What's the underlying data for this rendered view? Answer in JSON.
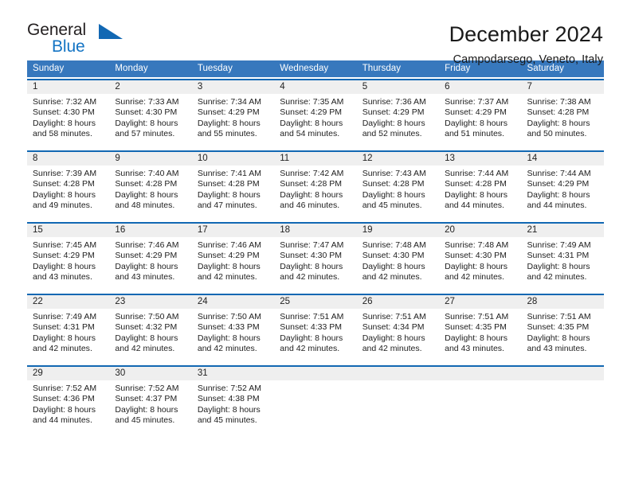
{
  "logo": {
    "word1": "General",
    "word2": "Blue",
    "triangle_color": "#1268b3",
    "word2_color": "#1474c4"
  },
  "header": {
    "title": "December 2024",
    "subtitle": "Campodarsego, Veneto, Italy"
  },
  "theme": {
    "header_row_bg": "#3778bd",
    "week_border": "#1268b3",
    "day_band_bg": "#efefef",
    "text": "#1a1a1a"
  },
  "weekdays": [
    "Sunday",
    "Monday",
    "Tuesday",
    "Wednesday",
    "Thursday",
    "Friday",
    "Saturday"
  ],
  "weeks": [
    [
      {
        "day": "1",
        "sunrise": "Sunrise: 7:32 AM",
        "sunset": "Sunset: 4:30 PM",
        "daylight1": "Daylight: 8 hours",
        "daylight2": "and 58 minutes."
      },
      {
        "day": "2",
        "sunrise": "Sunrise: 7:33 AM",
        "sunset": "Sunset: 4:30 PM",
        "daylight1": "Daylight: 8 hours",
        "daylight2": "and 57 minutes."
      },
      {
        "day": "3",
        "sunrise": "Sunrise: 7:34 AM",
        "sunset": "Sunset: 4:29 PM",
        "daylight1": "Daylight: 8 hours",
        "daylight2": "and 55 minutes."
      },
      {
        "day": "4",
        "sunrise": "Sunrise: 7:35 AM",
        "sunset": "Sunset: 4:29 PM",
        "daylight1": "Daylight: 8 hours",
        "daylight2": "and 54 minutes."
      },
      {
        "day": "5",
        "sunrise": "Sunrise: 7:36 AM",
        "sunset": "Sunset: 4:29 PM",
        "daylight1": "Daylight: 8 hours",
        "daylight2": "and 52 minutes."
      },
      {
        "day": "6",
        "sunrise": "Sunrise: 7:37 AM",
        "sunset": "Sunset: 4:29 PM",
        "daylight1": "Daylight: 8 hours",
        "daylight2": "and 51 minutes."
      },
      {
        "day": "7",
        "sunrise": "Sunrise: 7:38 AM",
        "sunset": "Sunset: 4:28 PM",
        "daylight1": "Daylight: 8 hours",
        "daylight2": "and 50 minutes."
      }
    ],
    [
      {
        "day": "8",
        "sunrise": "Sunrise: 7:39 AM",
        "sunset": "Sunset: 4:28 PM",
        "daylight1": "Daylight: 8 hours",
        "daylight2": "and 49 minutes."
      },
      {
        "day": "9",
        "sunrise": "Sunrise: 7:40 AM",
        "sunset": "Sunset: 4:28 PM",
        "daylight1": "Daylight: 8 hours",
        "daylight2": "and 48 minutes."
      },
      {
        "day": "10",
        "sunrise": "Sunrise: 7:41 AM",
        "sunset": "Sunset: 4:28 PM",
        "daylight1": "Daylight: 8 hours",
        "daylight2": "and 47 minutes."
      },
      {
        "day": "11",
        "sunrise": "Sunrise: 7:42 AM",
        "sunset": "Sunset: 4:28 PM",
        "daylight1": "Daylight: 8 hours",
        "daylight2": "and 46 minutes."
      },
      {
        "day": "12",
        "sunrise": "Sunrise: 7:43 AM",
        "sunset": "Sunset: 4:28 PM",
        "daylight1": "Daylight: 8 hours",
        "daylight2": "and 45 minutes."
      },
      {
        "day": "13",
        "sunrise": "Sunrise: 7:44 AM",
        "sunset": "Sunset: 4:28 PM",
        "daylight1": "Daylight: 8 hours",
        "daylight2": "and 44 minutes."
      },
      {
        "day": "14",
        "sunrise": "Sunrise: 7:44 AM",
        "sunset": "Sunset: 4:29 PM",
        "daylight1": "Daylight: 8 hours",
        "daylight2": "and 44 minutes."
      }
    ],
    [
      {
        "day": "15",
        "sunrise": "Sunrise: 7:45 AM",
        "sunset": "Sunset: 4:29 PM",
        "daylight1": "Daylight: 8 hours",
        "daylight2": "and 43 minutes."
      },
      {
        "day": "16",
        "sunrise": "Sunrise: 7:46 AM",
        "sunset": "Sunset: 4:29 PM",
        "daylight1": "Daylight: 8 hours",
        "daylight2": "and 43 minutes."
      },
      {
        "day": "17",
        "sunrise": "Sunrise: 7:46 AM",
        "sunset": "Sunset: 4:29 PM",
        "daylight1": "Daylight: 8 hours",
        "daylight2": "and 42 minutes."
      },
      {
        "day": "18",
        "sunrise": "Sunrise: 7:47 AM",
        "sunset": "Sunset: 4:30 PM",
        "daylight1": "Daylight: 8 hours",
        "daylight2": "and 42 minutes."
      },
      {
        "day": "19",
        "sunrise": "Sunrise: 7:48 AM",
        "sunset": "Sunset: 4:30 PM",
        "daylight1": "Daylight: 8 hours",
        "daylight2": "and 42 minutes."
      },
      {
        "day": "20",
        "sunrise": "Sunrise: 7:48 AM",
        "sunset": "Sunset: 4:30 PM",
        "daylight1": "Daylight: 8 hours",
        "daylight2": "and 42 minutes."
      },
      {
        "day": "21",
        "sunrise": "Sunrise: 7:49 AM",
        "sunset": "Sunset: 4:31 PM",
        "daylight1": "Daylight: 8 hours",
        "daylight2": "and 42 minutes."
      }
    ],
    [
      {
        "day": "22",
        "sunrise": "Sunrise: 7:49 AM",
        "sunset": "Sunset: 4:31 PM",
        "daylight1": "Daylight: 8 hours",
        "daylight2": "and 42 minutes."
      },
      {
        "day": "23",
        "sunrise": "Sunrise: 7:50 AM",
        "sunset": "Sunset: 4:32 PM",
        "daylight1": "Daylight: 8 hours",
        "daylight2": "and 42 minutes."
      },
      {
        "day": "24",
        "sunrise": "Sunrise: 7:50 AM",
        "sunset": "Sunset: 4:33 PM",
        "daylight1": "Daylight: 8 hours",
        "daylight2": "and 42 minutes."
      },
      {
        "day": "25",
        "sunrise": "Sunrise: 7:51 AM",
        "sunset": "Sunset: 4:33 PM",
        "daylight1": "Daylight: 8 hours",
        "daylight2": "and 42 minutes."
      },
      {
        "day": "26",
        "sunrise": "Sunrise: 7:51 AM",
        "sunset": "Sunset: 4:34 PM",
        "daylight1": "Daylight: 8 hours",
        "daylight2": "and 42 minutes."
      },
      {
        "day": "27",
        "sunrise": "Sunrise: 7:51 AM",
        "sunset": "Sunset: 4:35 PM",
        "daylight1": "Daylight: 8 hours",
        "daylight2": "and 43 minutes."
      },
      {
        "day": "28",
        "sunrise": "Sunrise: 7:51 AM",
        "sunset": "Sunset: 4:35 PM",
        "daylight1": "Daylight: 8 hours",
        "daylight2": "and 43 minutes."
      }
    ],
    [
      {
        "day": "29",
        "sunrise": "Sunrise: 7:52 AM",
        "sunset": "Sunset: 4:36 PM",
        "daylight1": "Daylight: 8 hours",
        "daylight2": "and 44 minutes."
      },
      {
        "day": "30",
        "sunrise": "Sunrise: 7:52 AM",
        "sunset": "Sunset: 4:37 PM",
        "daylight1": "Daylight: 8 hours",
        "daylight2": "and 45 minutes."
      },
      {
        "day": "31",
        "sunrise": "Sunrise: 7:52 AM",
        "sunset": "Sunset: 4:38 PM",
        "daylight1": "Daylight: 8 hours",
        "daylight2": "and 45 minutes."
      },
      {
        "day": "",
        "sunrise": "",
        "sunset": "",
        "daylight1": "",
        "daylight2": ""
      },
      {
        "day": "",
        "sunrise": "",
        "sunset": "",
        "daylight1": "",
        "daylight2": ""
      },
      {
        "day": "",
        "sunrise": "",
        "sunset": "",
        "daylight1": "",
        "daylight2": ""
      },
      {
        "day": "",
        "sunrise": "",
        "sunset": "",
        "daylight1": "",
        "daylight2": ""
      }
    ]
  ]
}
